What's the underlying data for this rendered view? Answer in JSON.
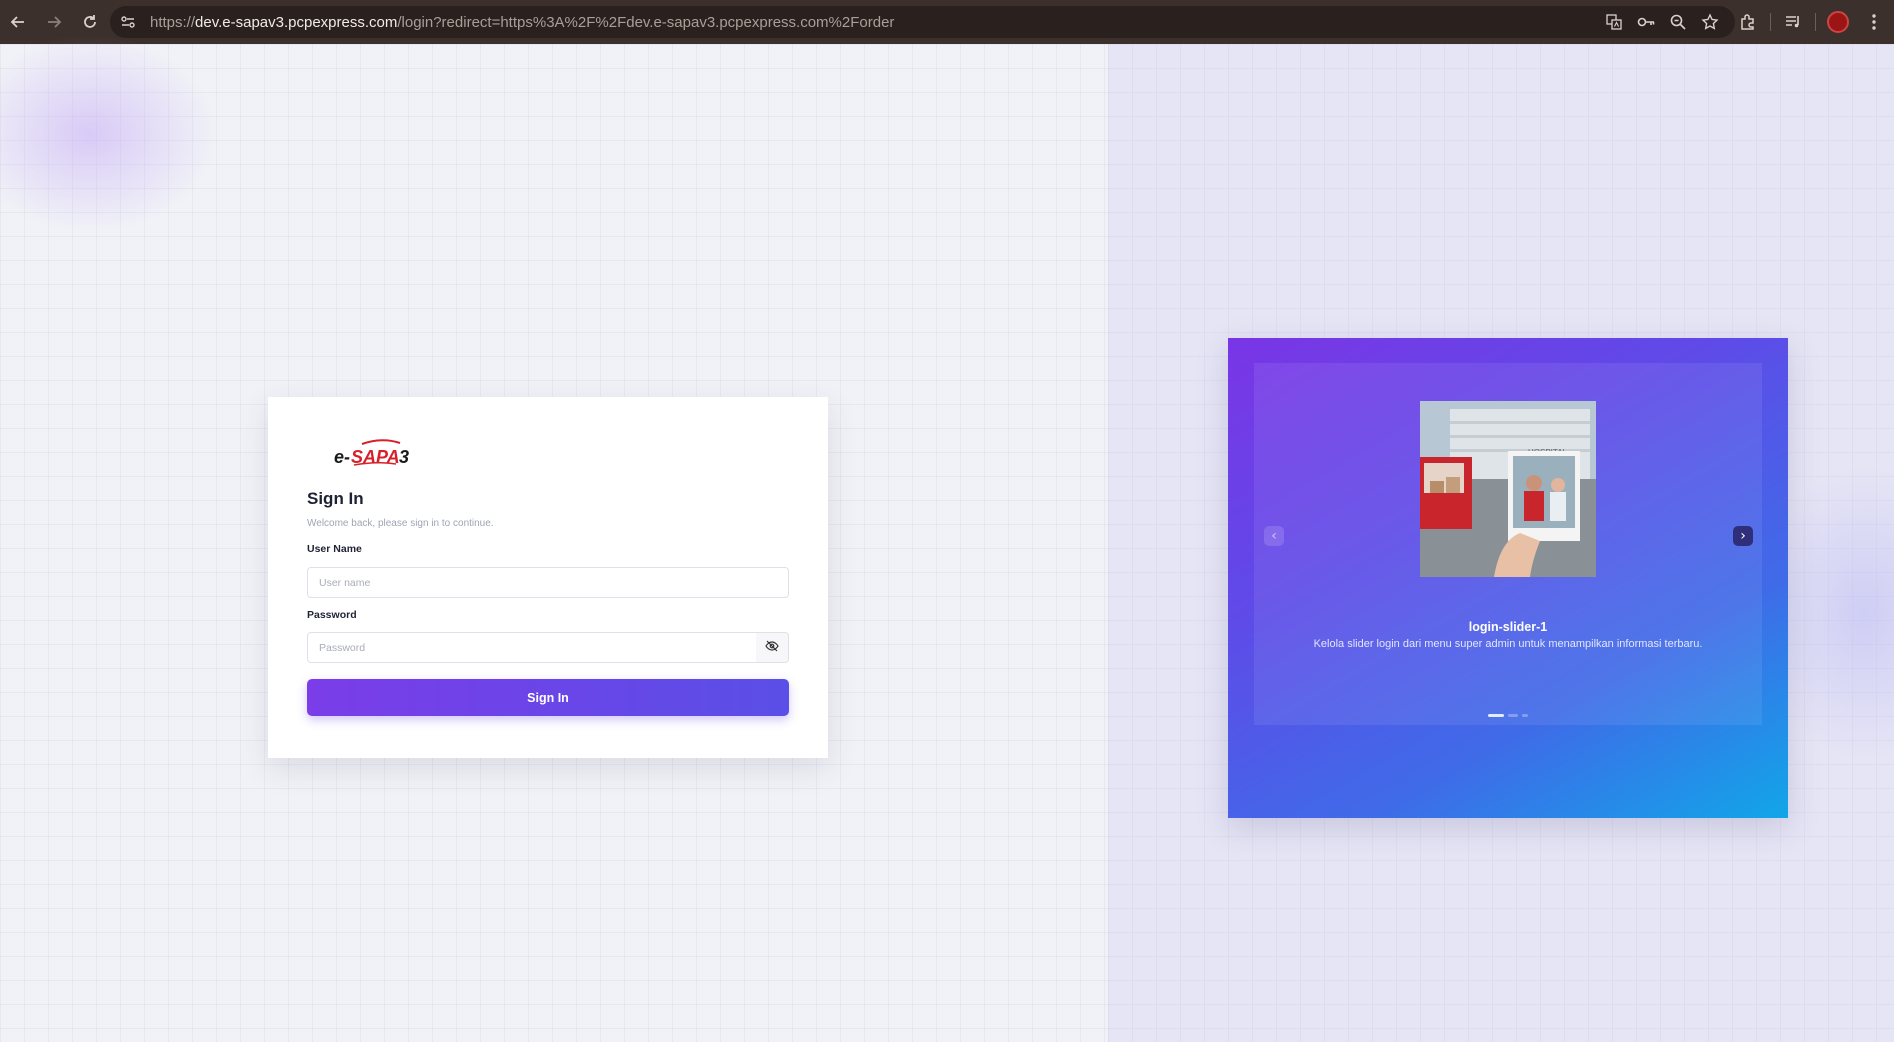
{
  "browser": {
    "url_scheme": "https://",
    "url_host": "dev.e-sapav3.pcpexpress.com",
    "url_rest": "/login?redirect=https%3A%2F%2Fdev.e-sapav3.pcpexpress.com%2Forder",
    "icons": [
      "back-icon",
      "forward-icon",
      "reload-icon",
      "site-info-icon",
      "translate-icon",
      "password-key-icon",
      "zoom-icon",
      "bookmark-star-icon",
      "extensions-icon",
      "media-controls-icon",
      "profile-avatar",
      "menu-icon"
    ]
  },
  "login": {
    "logo_text": "e-SAPA3",
    "title": "Sign In",
    "subtitle": "Welcome back, please sign in to continue.",
    "username_label": "User Name",
    "username_placeholder": "User name",
    "username_value": "",
    "password_label": "Password",
    "password_placeholder": "Password",
    "password_value": "",
    "submit_label": "Sign In"
  },
  "slider": {
    "active_index": 0,
    "slide_count": 3,
    "slides": [
      {
        "title": "login-slider-1",
        "description": "Kelola slider login dari menu super admin untuk menampilkan informasi terbaru.",
        "image_sign": "HOSPITAL"
      }
    ]
  },
  "colors": {
    "brand_purple": "#6a45e8",
    "logo_red": "#d8202a",
    "slider_gradient_start": "#7a35e6",
    "slider_gradient_end": "#11a6e8"
  }
}
